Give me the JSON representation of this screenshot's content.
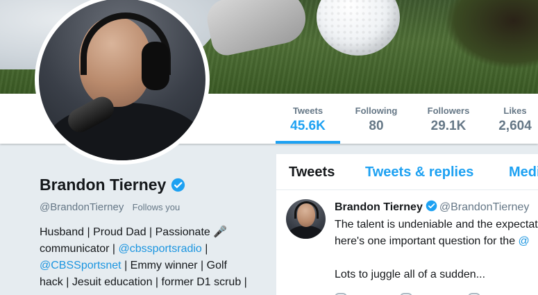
{
  "profile": {
    "name": "Brandon Tierney",
    "handle": "@BrandonTierney",
    "follows_you": "Follows you",
    "bio_line1": "Husband | Proud Dad | Passionate 🎤",
    "bio_line2_pre": "communicator | ",
    "bio_link1": "@cbssportsradio",
    "bio_line2_post": " |",
    "bio_link2": "@CBSSportsnet",
    "bio_line3_post": " | Emmy winner | Golf",
    "bio_line4": "hack | Jesuit education | former D1 scrub |"
  },
  "stats": [
    {
      "label": "Tweets",
      "value": "45.6K"
    },
    {
      "label": "Following",
      "value": "80"
    },
    {
      "label": "Followers",
      "value": "29.1K"
    },
    {
      "label": "Likes",
      "value": "2,604"
    }
  ],
  "tabs": [
    "Tweets",
    "Tweets & replies",
    "Media"
  ],
  "tweet": {
    "name": "Brandon Tierney",
    "handle": "@BrandonTierney",
    "line1": "The talent is undeniable and the expectations",
    "line2_pre": "here's one important question for the ",
    "line2_link": "@",
    "line3": "Lots to juggle all of a sudden..."
  },
  "colors": {
    "accent": "#1da1f2",
    "link": "#1b95e0",
    "muted": "#657786",
    "background": "#e6ecf0"
  },
  "icons": [
    "verified-badge-icon",
    "reply-icon",
    "retweet-icon",
    "like-icon"
  ]
}
